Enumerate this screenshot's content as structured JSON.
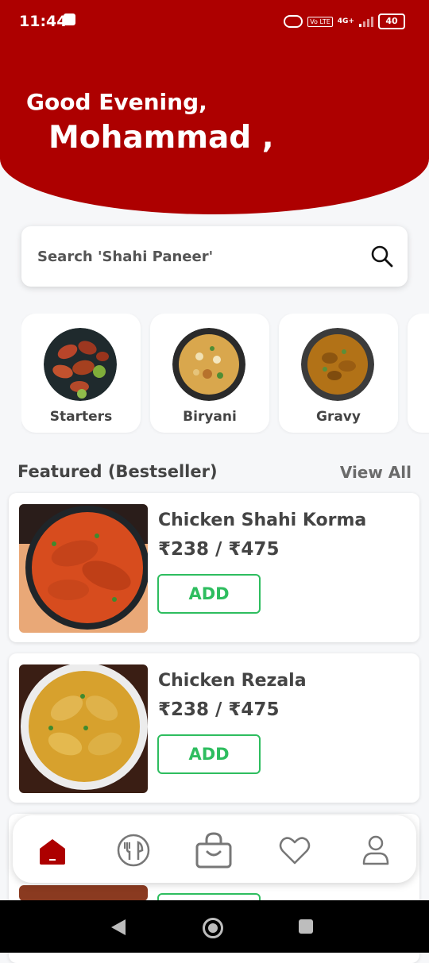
{
  "status_bar": {
    "time": "11:44",
    "volte": "Vo LTE",
    "network": "4G+",
    "battery": "40"
  },
  "header": {
    "greeting": "Good Evening,",
    "user_name": "Mohammad ,"
  },
  "search": {
    "placeholder": "Search 'Shahi Paneer'"
  },
  "categories": [
    {
      "label": "Starters"
    },
    {
      "label": "Biryani"
    },
    {
      "label": "Gravy"
    }
  ],
  "featured": {
    "title": "Featured (Bestseller)",
    "view_all": "View All",
    "items": [
      {
        "name": "Chicken Shahi Korma",
        "price": "₹238 / ₹475",
        "button": "ADD"
      },
      {
        "name": "Chicken Rezala",
        "price": "₹238 / ₹475",
        "button": "ADD"
      }
    ]
  },
  "bottom_nav": [
    "home-icon",
    "menu-icon",
    "bag-icon",
    "heart-icon",
    "profile-icon"
  ],
  "colors": {
    "brand": "#ad0000",
    "add_green": "#2ebd5f"
  }
}
